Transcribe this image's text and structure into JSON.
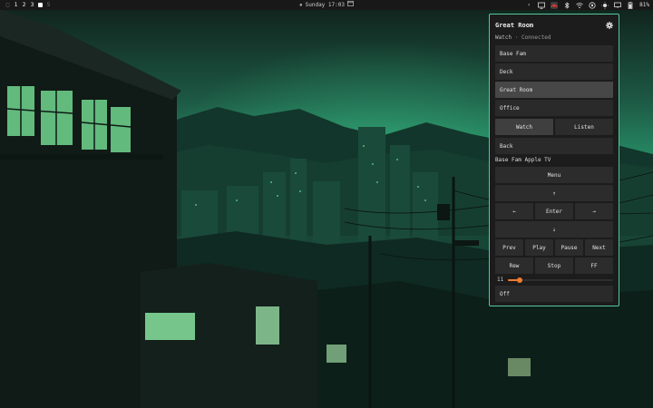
{
  "topbar": {
    "workspaces": [
      "1",
      "2",
      "3",
      "5"
    ],
    "clock": "Sunday 17:03",
    "battery": "81%",
    "tray_icons": [
      "chevron-left-icon",
      "tv-icon",
      "home-assistant-icon",
      "bluetooth-icon",
      "wifi-icon",
      "screen-share-icon",
      "brightness-icon",
      "monitor-icon",
      "battery-icon"
    ]
  },
  "panel": {
    "title": "Great Room",
    "subtitle_mode": "Watch",
    "subtitle_sep": "·",
    "subtitle_status": "Connected",
    "rooms": [
      {
        "label": "Base Fam",
        "selected": false
      },
      {
        "label": "Deck",
        "selected": false
      },
      {
        "label": "Great Room",
        "selected": true
      },
      {
        "label": "Office",
        "selected": false
      }
    ],
    "modes": {
      "watch": "Watch",
      "listen": "Listen",
      "active": "watch"
    },
    "back": "Back",
    "device": "Base Fam Apple TV",
    "remote": {
      "menu": "Menu",
      "up": "↑",
      "left": "←",
      "enter": "Enter",
      "right": "→",
      "down": "↓"
    },
    "transport": {
      "prev": "Prev",
      "play": "Play",
      "pause": "Pause",
      "next": "Next",
      "rew": "Rew",
      "stop": "Stop",
      "ff": "FF"
    },
    "volume": {
      "value": "11",
      "level": 0.11
    },
    "off": "Off"
  },
  "colors": {
    "accent_border": "#55c79c",
    "slider": "#f07b30",
    "panel_bg": "#1c1c1c"
  }
}
